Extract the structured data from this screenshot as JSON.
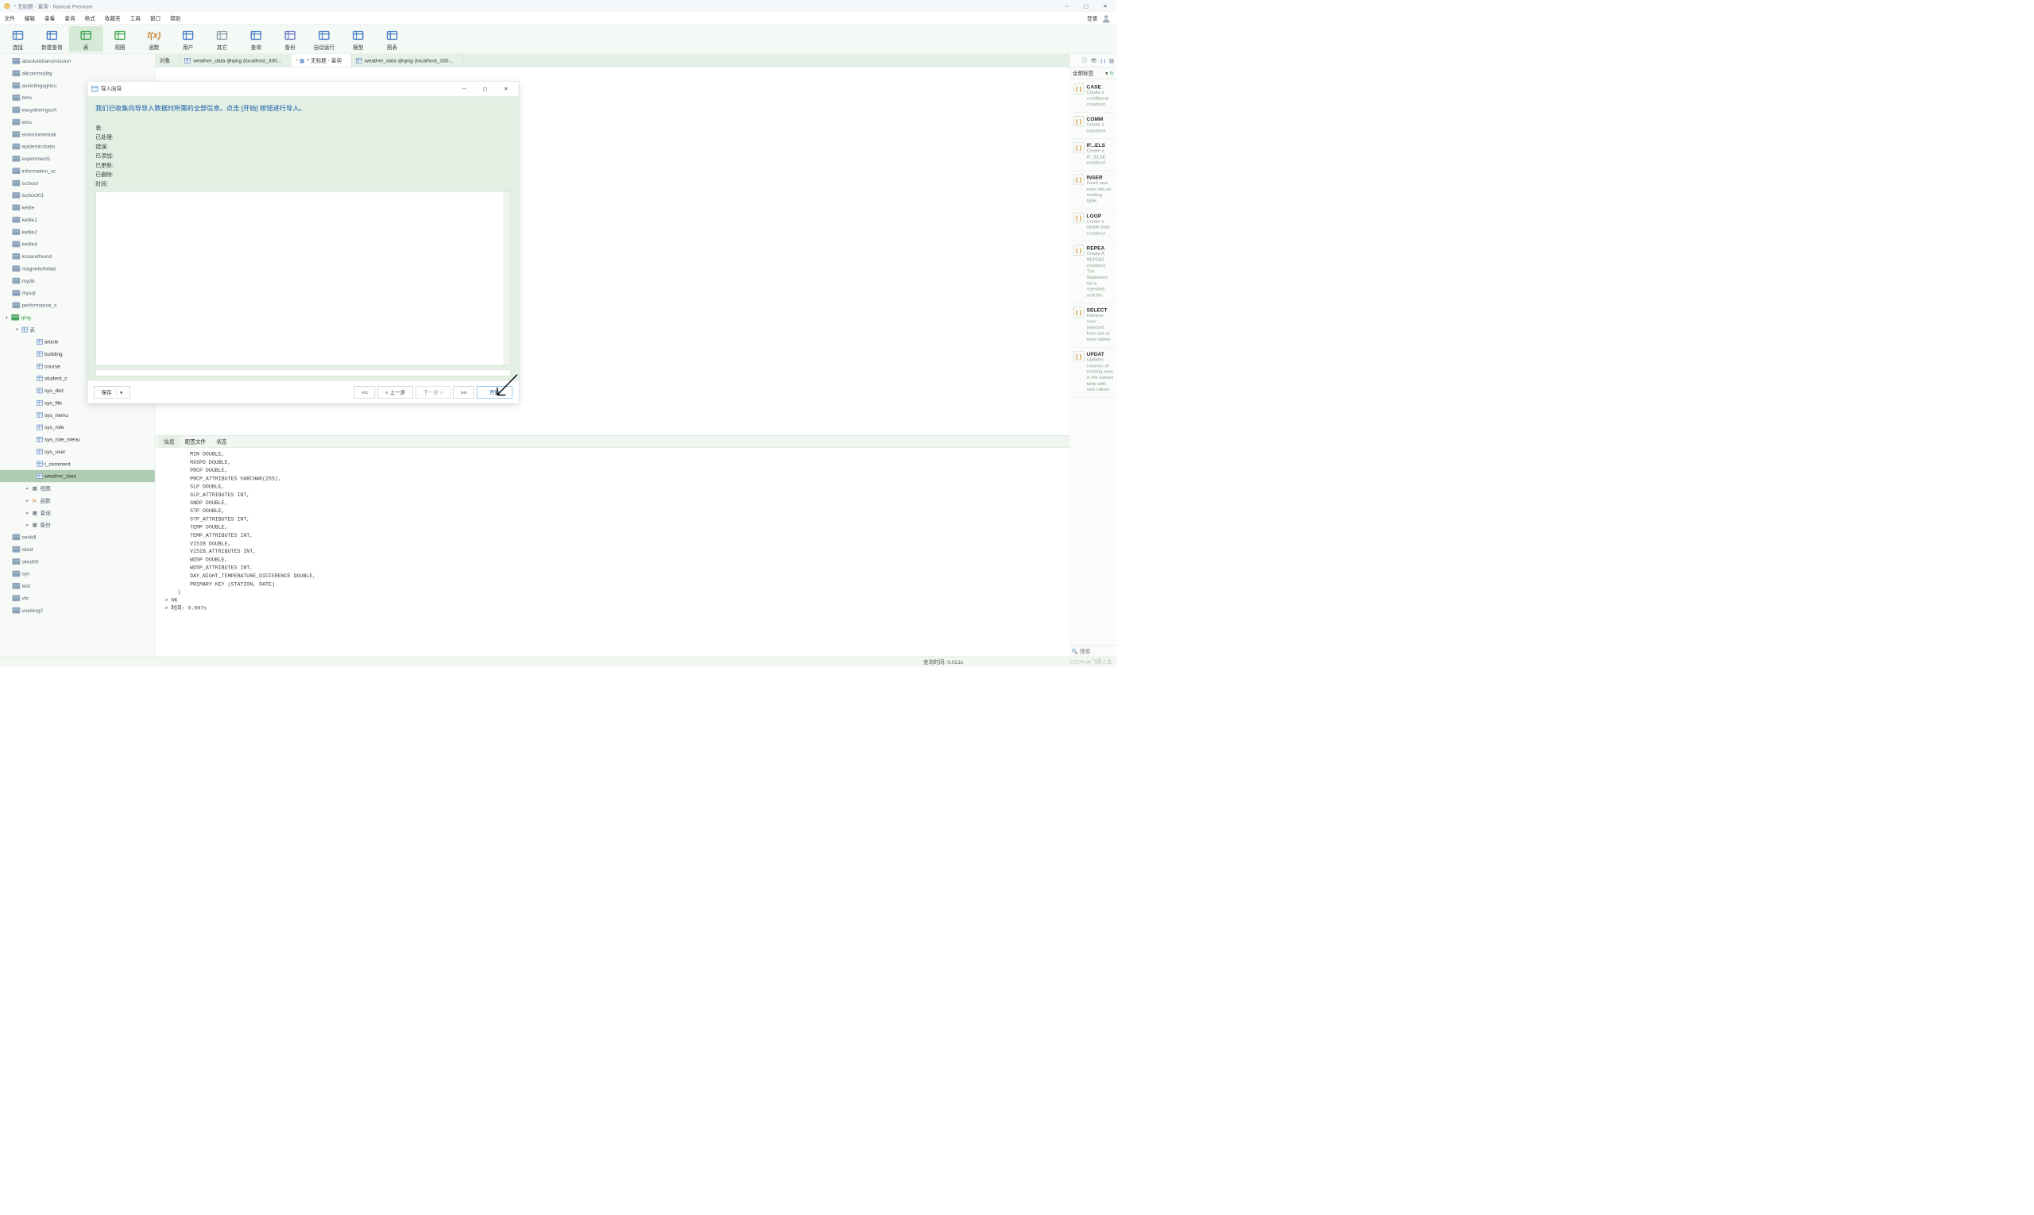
{
  "window": {
    "title": "* 无标题 - 查询 - Navicat Premium",
    "min_tip": "最小化",
    "max_tip": "最大化",
    "close_tip": "关闭"
  },
  "menu": {
    "items": [
      "文件",
      "编辑",
      "查看",
      "查询",
      "格式",
      "收藏夹",
      "工具",
      "窗口",
      "帮助"
    ],
    "login": "登录"
  },
  "toolbar": {
    "items": [
      {
        "label": "连接",
        "color": "#3e78c2"
      },
      {
        "label": "新建查询",
        "color": "#3e78c2"
      },
      {
        "label": "表",
        "color": "#3aa24a",
        "active": true
      },
      {
        "label": "视图",
        "color": "#3aa24a"
      },
      {
        "label": "函数",
        "color": "#c4833c",
        "text": "f(x)"
      },
      {
        "label": "用户",
        "color": "#3e78c2"
      },
      {
        "label": "其它",
        "color": "#8d9aa6"
      },
      {
        "label": "查询",
        "color": "#3e78c2"
      },
      {
        "label": "备份",
        "color": "#6573c4"
      },
      {
        "label": "自动运行",
        "color": "#3e78c2"
      },
      {
        "label": "模型",
        "color": "#3e78c2"
      },
      {
        "label": "图表",
        "color": "#3e78c2"
      }
    ]
  },
  "sidebar": {
    "dbs_top": [
      "absolutetransmission",
      "allcommodity",
      "assistingagricu",
      "bms",
      "easydrivingsch",
      "ems",
      "environmentali",
      "epidemicstatis",
      "experiment1",
      "information_sc",
      "ischool",
      "ischool01",
      "kettle",
      "kettle1",
      "kettle2",
      "kettle4",
      "lostandfound",
      "magneticfieldd",
      "mydb",
      "mysql",
      "performance_s"
    ],
    "open_db": "qing",
    "open_folder": "表",
    "tables": [
      "article",
      "building",
      "course",
      "student_c",
      "sys_dict",
      "sys_file",
      "sys_menu",
      "sys_role",
      "sys_role_menu",
      "sys_user",
      "t_comment",
      "weather_data"
    ],
    "selected_table": "weather_data",
    "subnodes": [
      {
        "label": "视图"
      },
      {
        "label": "函数",
        "ico": "fx"
      },
      {
        "label": "查询"
      },
      {
        "label": "备份"
      }
    ],
    "dbs_bottom": [
      "seckill",
      "sked",
      "sked00",
      "sys",
      "test",
      "vhr",
      "vueblog2"
    ]
  },
  "tabs": {
    "items": [
      {
        "label": "对象"
      },
      {
        "label": "weather_data @qing (localhost_330...",
        "ico": "tbl"
      },
      {
        "label": "* 无标题 - 查询",
        "ico": "query",
        "active": true
      },
      {
        "label": "weather_data @qing (localhost_330...",
        "ico": "tbl"
      }
    ]
  },
  "subtabs": {
    "items": [
      "信息",
      "配置文件",
      "状态"
    ],
    "active": 0
  },
  "output_lines": [
    "        MIN DOUBLE,",
    "        MXSPD DOUBLE,",
    "        PRCP DOUBLE,",
    "        PRCP_ATTRIBUTES VARCHAR(255),",
    "        SLP DOUBLE,",
    "        SLP_ATTRIBUTES INT,",
    "        SNDP DOUBLE,",
    "        STP DOUBLE,",
    "        STP_ATTRIBUTES INT,",
    "        TEMP DOUBLE,",
    "        TEMP_ATTRIBUTES INT,",
    "        VISIB DOUBLE,",
    "        VISIB_ATTRIBUTES INT,",
    "        WDSP DOUBLE,",
    "        WDSP_ATTRIBUTES INT,",
    "        DAY_NIGHT_TEMPERATURE_DIFFERENCE DOUBLE,",
    "        PRIMARY KEY (STATION, DATE)",
    "    )",
    "> OK",
    "> 时间: 0.007s"
  ],
  "status": {
    "query_time_label": "查询时间:",
    "query_time_value": "0.021s"
  },
  "watermark": "CSDN @飞腾人生",
  "right": {
    "filter": "全部标签",
    "search_placeholder": "搜索",
    "snippets": [
      {
        "title": "CASE",
        "desc": "Create a conditional construct"
      },
      {
        "title": "COMM",
        "desc": "Create a comment"
      },
      {
        "title": "IF...ELS",
        "desc": "Create a IF...ELSE construct"
      },
      {
        "title": "INSER",
        "desc": "Insert new rows into an existing table"
      },
      {
        "title": "LOOP",
        "desc": "Create a simple loop construct"
      },
      {
        "title": "REPEA",
        "desc": "Create A REPEAT construct. The Statement list is repeated until the"
      },
      {
        "title": "SELECT",
        "desc": "Retrieve rows selected from one or more tables"
      },
      {
        "title": "UPDAT",
        "desc": "Updates columns of existing rows in the named table with new values"
      }
    ]
  },
  "dialog": {
    "title": "导入向导",
    "headline": "我们已收集向导导入数据时所需的全部信息。点击 [开始] 按钮进行导入。",
    "fields": [
      "表:",
      "已处理:",
      "错误:",
      "已添加:",
      "已更新:",
      "已删除:",
      "时间:"
    ],
    "btn_save": "保存",
    "btn_first": "<<",
    "btn_prev": "< 上一步",
    "btn_next": "下一步 >",
    "btn_last": ">>",
    "btn_start": "开始"
  }
}
